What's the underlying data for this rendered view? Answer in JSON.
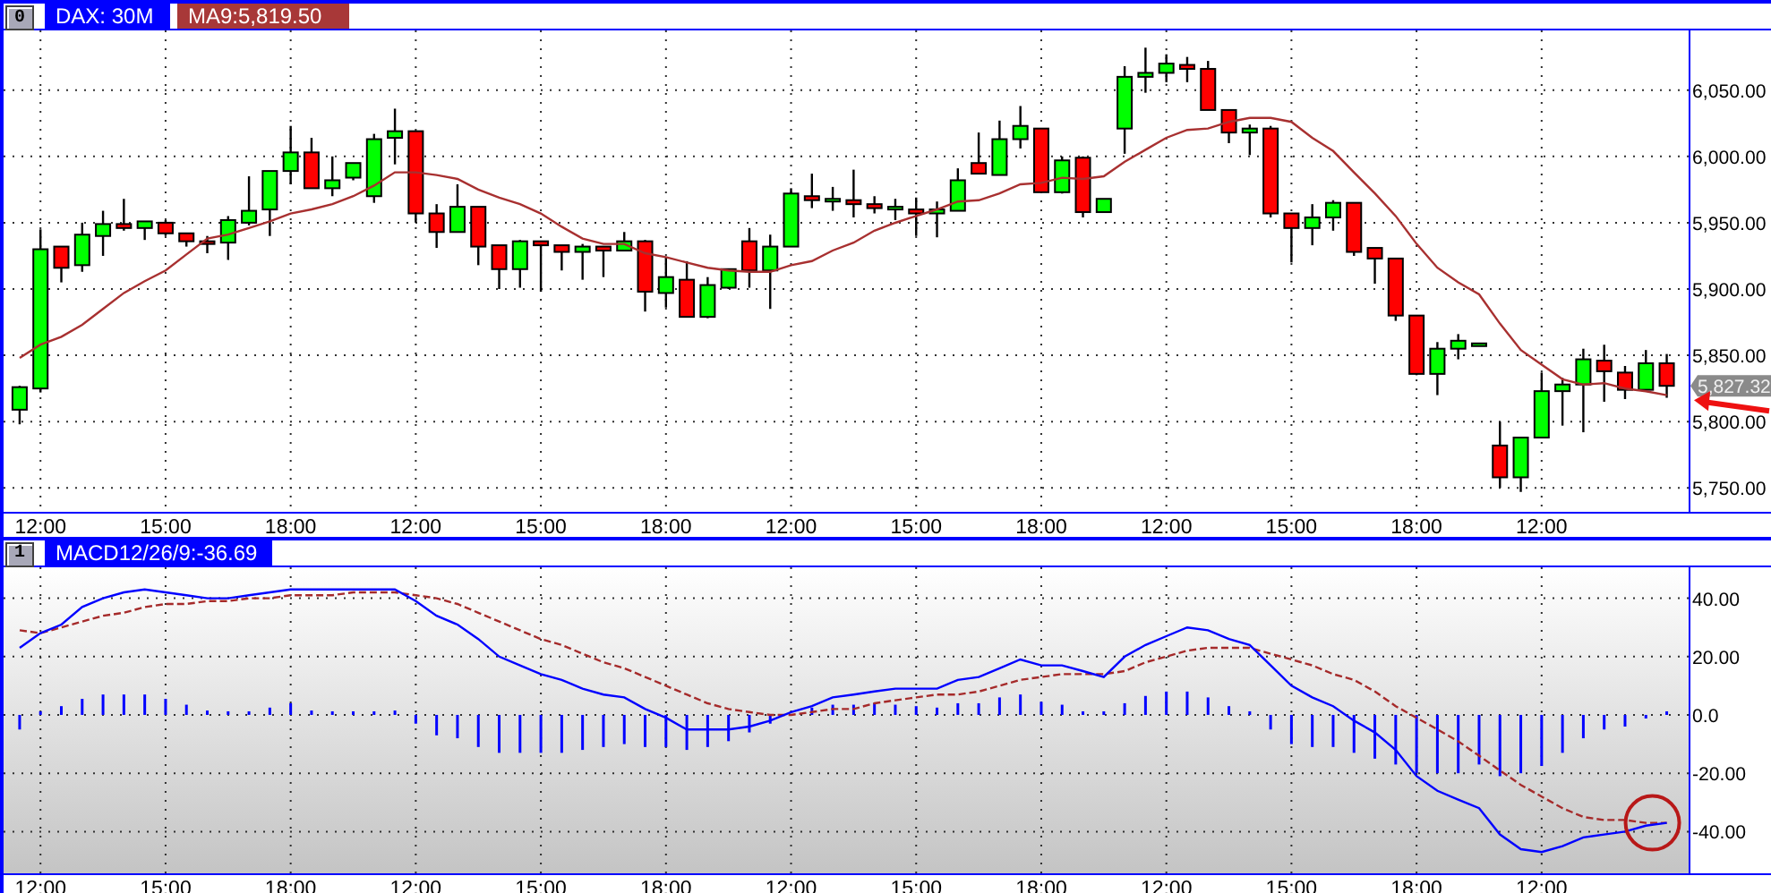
{
  "panels": [
    {
      "kind": "price",
      "index": "0",
      "title": "DAX: 30M",
      "indicator": "MA9:5,819.50",
      "last_price": "5,827.32",
      "chart_data": {
        "type": "candlestick",
        "grid": true,
        "categories": [
          null,
          "12:00",
          null,
          null,
          null,
          null,
          null,
          "15:00",
          null,
          null,
          null,
          null,
          null,
          "18:00",
          null,
          null,
          null,
          null,
          null,
          "12:00",
          null,
          null,
          null,
          null,
          null,
          "15:00",
          null,
          null,
          null,
          null,
          null,
          "18:00",
          null,
          null,
          null,
          null,
          null,
          "12:00",
          null,
          null,
          null,
          null,
          null,
          "15:00",
          null,
          null,
          null,
          null,
          null,
          "18:00",
          null,
          null,
          null,
          null,
          null,
          "12:00",
          null,
          null,
          null,
          null,
          null,
          "15:00",
          null,
          null,
          null,
          null,
          null,
          "18:00",
          null,
          null,
          null,
          null,
          null,
          "12:00",
          null,
          null,
          null,
          null,
          null,
          null
        ],
        "ylim": [
          5732,
          6095
        ],
        "yticks": [
          {
            "value": 5750,
            "label": "5,750.00"
          },
          {
            "value": 5800,
            "label": "5,800.00"
          },
          {
            "value": 5850,
            "label": "5,850.00"
          },
          {
            "value": 5900,
            "label": "5,900.00"
          },
          {
            "value": 5950,
            "label": "5,950.00"
          },
          {
            "value": 6000,
            "label": "6,000.00"
          },
          {
            "value": 6050,
            "label": "6,050.00"
          }
        ],
        "ohlc": [
          [
            5809,
            5827,
            5798,
            5826
          ],
          [
            5825,
            5945,
            5822,
            5930
          ],
          [
            5932,
            5932,
            5905,
            5916
          ],
          [
            5918,
            5950,
            5913,
            5941
          ],
          [
            5940,
            5959,
            5925,
            5949
          ],
          [
            5949,
            5968,
            5944,
            5946
          ],
          [
            5946,
            5951,
            5937,
            5951
          ],
          [
            5950,
            5952,
            5940,
            5942
          ],
          [
            5942,
            5942,
            5932,
            5936
          ],
          [
            5936,
            5940,
            5927,
            5935
          ],
          [
            5935,
            5955,
            5922,
            5952
          ],
          [
            5950,
            5985,
            5948,
            5959
          ],
          [
            5960,
            5989,
            5940,
            5989
          ],
          [
            5989,
            6023,
            5979,
            6003
          ],
          [
            6003,
            6014,
            5976,
            5976
          ],
          [
            5976,
            6000,
            5970,
            5982
          ],
          [
            5984,
            5995,
            5982,
            5995
          ],
          [
            5970,
            6017,
            5965,
            6013
          ],
          [
            6014,
            6036,
            5994,
            6019
          ],
          [
            6019,
            6019,
            5950,
            5957
          ],
          [
            5957,
            5964,
            5931,
            5943
          ],
          [
            5943,
            5979,
            5943,
            5962
          ],
          [
            5962,
            5962,
            5918,
            5932
          ],
          [
            5933,
            5933,
            5900,
            5915
          ],
          [
            5915,
            5937,
            5901,
            5936
          ],
          [
            5936,
            5936,
            5898,
            5933
          ],
          [
            5933,
            5933,
            5914,
            5928
          ],
          [
            5928,
            5934,
            5907,
            5932
          ],
          [
            5932,
            5932,
            5909,
            5929
          ],
          [
            5929,
            5943,
            5929,
            5936
          ],
          [
            5936,
            5937,
            5883,
            5898
          ],
          [
            5897,
            5924,
            5886,
            5909
          ],
          [
            5907,
            5921,
            5879,
            5879
          ],
          [
            5879,
            5909,
            5878,
            5903
          ],
          [
            5901,
            5915,
            5900,
            5915
          ],
          [
            5936,
            5946,
            5901,
            5914
          ],
          [
            5914,
            5941,
            5885,
            5932
          ],
          [
            5932,
            5976,
            5932,
            5972
          ],
          [
            5970,
            5987,
            5961,
            5967
          ],
          [
            5967,
            5977,
            5959,
            5968
          ],
          [
            5967,
            5990,
            5954,
            5964
          ],
          [
            5964,
            5970,
            5957,
            5961
          ],
          [
            5961,
            5968,
            5952,
            5962
          ],
          [
            5960,
            5969,
            5940,
            5957
          ],
          [
            5957,
            5966,
            5939,
            5960
          ],
          [
            5959,
            5991,
            5959,
            5982
          ],
          [
            5995,
            6018,
            5987,
            5987
          ],
          [
            5986,
            6027,
            5986,
            6013
          ],
          [
            6013,
            6038,
            6006,
            6023
          ],
          [
            6021,
            6021,
            5973,
            5973
          ],
          [
            5973,
            6000,
            5972,
            5997
          ],
          [
            5999,
            6000,
            5954,
            5958
          ],
          [
            5958,
            5968,
            5958,
            5968
          ],
          [
            6021,
            6068,
            6002,
            6060
          ],
          [
            6060,
            6082,
            6048,
            6063
          ],
          [
            6063,
            6077,
            6056,
            6070
          ],
          [
            6069,
            6075,
            6056,
            6066
          ],
          [
            6066,
            6072,
            6035,
            6035
          ],
          [
            6035,
            6035,
            6010,
            6018
          ],
          [
            6018,
            6024,
            6001,
            6021
          ],
          [
            6021,
            6023,
            5954,
            5957
          ],
          [
            5957,
            5957,
            5920,
            5946
          ],
          [
            5946,
            5964,
            5933,
            5954
          ],
          [
            5954,
            5967,
            5944,
            5965
          ],
          [
            5965,
            5965,
            5925,
            5928
          ],
          [
            5931,
            5931,
            5904,
            5923
          ],
          [
            5923,
            5923,
            5876,
            5880
          ],
          [
            5880,
            5880,
            5835,
            5836
          ],
          [
            5836,
            5860,
            5820,
            5855
          ],
          [
            5855,
            5866,
            5847,
            5861
          ],
          [
            5859,
            5859,
            5859,
            5859
          ],
          [
            5782,
            5800,
            5750,
            5758
          ],
          [
            5758,
            5788,
            5747,
            5788
          ],
          [
            5788,
            5837,
            5788,
            5823
          ],
          [
            5823,
            5833,
            5797,
            5828
          ],
          [
            5828,
            5855,
            5792,
            5847
          ],
          [
            5846,
            5858,
            5815,
            5838
          ],
          [
            5837,
            5842,
            5817,
            5824
          ],
          [
            5824,
            5854,
            5824,
            5844
          ],
          [
            5844,
            5851,
            5818,
            5827
          ]
        ],
        "series": [
          {
            "type": "line",
            "color": "#a83030",
            "line_style": "solid",
            "values": [
              5848,
              5858,
              5864,
              5873,
              5885,
              5897,
              5906,
              5914,
              5926,
              5938,
              5941,
              5946,
              5951,
              5957,
              5960,
              5964,
              5970,
              5978,
              5988,
              5988,
              5986,
              5983,
              5975,
              5969,
              5964,
              5957,
              5947,
              5938,
              5934,
              5934,
              5927,
              5924,
              5920,
              5916,
              5914,
              5913,
              5913,
              5918,
              5921,
              5929,
              5935,
              5944,
              5950,
              5955,
              5960,
              5966,
              5967,
              5972,
              5979,
              5980,
              5984,
              5983,
              5985,
              5996,
              6005,
              6014,
              6020,
              6021,
              6026,
              6029,
              6029,
              6026,
              6014,
              6004,
              5988,
              5972,
              5955,
              5934,
              5916,
              5905,
              5896,
              5874,
              5854,
              5843,
              5832,
              5828,
              5829,
              5825,
              5823,
              5820
            ]
          }
        ]
      }
    },
    {
      "kind": "macd",
      "index": "1",
      "title": "MACD12/26/9:-36.69",
      "chart_data": {
        "type": "line",
        "grid": true,
        "categories": [
          null,
          "12:00",
          null,
          null,
          null,
          null,
          null,
          "15:00",
          null,
          null,
          null,
          null,
          null,
          "18:00",
          null,
          null,
          null,
          null,
          null,
          "12:00",
          null,
          null,
          null,
          null,
          null,
          "15:00",
          null,
          null,
          null,
          null,
          null,
          "18:00",
          null,
          null,
          null,
          null,
          null,
          "12:00",
          null,
          null,
          null,
          null,
          null,
          "15:00",
          null,
          null,
          null,
          null,
          null,
          "18:00",
          null,
          null,
          null,
          null,
          null,
          "12:00",
          null,
          null,
          null,
          null,
          null,
          "15:00",
          null,
          null,
          null,
          null,
          null,
          "18:00",
          null,
          null,
          null,
          null,
          null,
          "12:00",
          null,
          null,
          null,
          null,
          null,
          null
        ],
        "ylim": [
          -54.3,
          50.6
        ],
        "yticks": [
          {
            "value": 40,
            "label": "40.00"
          },
          {
            "value": 20,
            "label": "20.00"
          },
          {
            "value": 0,
            "label": "0.0"
          },
          {
            "value": -20,
            "label": "-20.00"
          },
          {
            "value": -40,
            "label": "-40.00"
          }
        ],
        "series": [
          {
            "type": "bar",
            "color": "#0000ff",
            "values": [
              -5,
              0.5,
              3,
              5.5,
              7,
              7,
              7,
              5.5,
              3.5,
              1.5,
              1,
              1,
              2.5,
              4,
              1.5,
              1,
              0.5,
              1,
              1.5,
              -3,
              -7,
              -8,
              -11,
              -13,
              -13,
              -13,
              -13,
              -12,
              -11,
              -10,
              -11,
              -11,
              -12,
              -11,
              -9,
              -6,
              -3,
              null,
              2.5,
              3.5,
              3.5,
              4,
              3.5,
              3,
              2.5,
              4,
              4,
              6,
              7,
              4.5,
              3.5,
              0.5,
              0.5,
              4,
              6.5,
              8,
              8,
              6,
              3,
              1,
              -5,
              -10,
              -11,
              -11,
              -13,
              -15,
              -17,
              -20,
              -20,
              -20,
              -17,
              -21,
              -20,
              -17.5,
              -13,
              -8,
              -5,
              -4,
              -0.5,
              0.5
            ]
          },
          {
            "type": "line",
            "color": "#a52a2a",
            "line_style": "dashed",
            "values": [
              29,
              28,
              30,
              32,
              34,
              35,
              37,
              38,
              38,
              39,
              39,
              40,
              40,
              41,
              41,
              41,
              42,
              42,
              42,
              41,
              40,
              38,
              35,
              32,
              29,
              26,
              24,
              21,
              18,
              16,
              13,
              10,
              7,
              4,
              2,
              1,
              0,
              0,
              1,
              2,
              2,
              4,
              5,
              6,
              7,
              7,
              8,
              10,
              12,
              13,
              14,
              14,
              14,
              15,
              18,
              20,
              22,
              23,
              23,
              23,
              21,
              19,
              17,
              14,
              12,
              8,
              3,
              -1,
              -5,
              -9,
              -14,
              -19,
              -24,
              -28,
              -32,
              -35,
              -36,
              -36,
              -37,
              -37
            ]
          },
          {
            "type": "line",
            "color": "#0000ff",
            "line_style": "solid",
            "values": [
              23,
              28,
              31,
              37,
              40,
              42,
              43,
              42,
              41,
              40,
              40,
              41,
              42,
              43,
              43,
              43,
              43,
              43,
              43,
              39,
              34,
              31,
              26,
              20,
              17,
              14,
              12,
              9,
              7,
              6,
              2,
              -1,
              -5,
              -5,
              -5,
              -4,
              -2,
              1,
              3,
              6,
              7,
              8,
              9,
              9,
              9,
              12,
              13,
              16,
              19,
              17,
              17,
              15,
              13,
              20,
              24,
              27,
              30,
              29,
              26,
              24,
              17,
              10,
              6,
              3,
              -2,
              -6,
              -12,
              -21,
              -26,
              -29,
              -32,
              -41,
              -46,
              -47,
              -45,
              -42,
              -41,
              -40,
              -38,
              -37
            ]
          }
        ]
      }
    }
  ]
}
